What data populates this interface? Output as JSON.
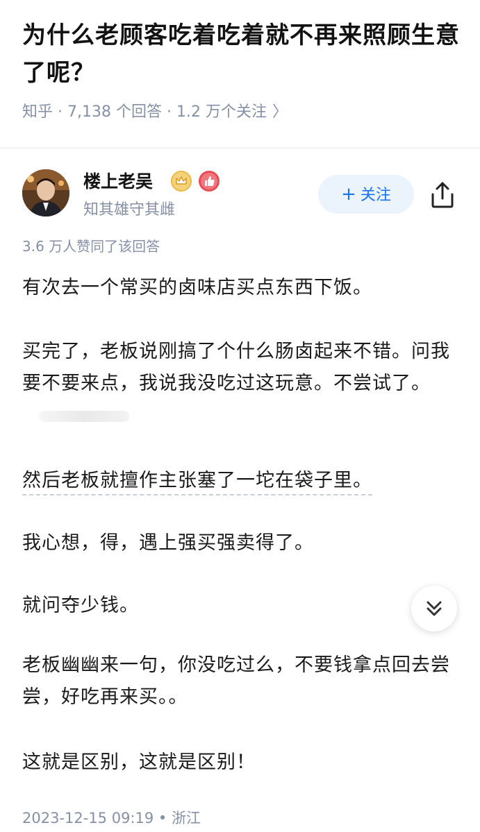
{
  "question": {
    "title": "为什么老顾客吃着吃着就不再来照顾生意了呢？",
    "source": "知乎",
    "answers": "7,138 个回答",
    "followers": "1.2 万个关注",
    "separator": " · ",
    "chevron": "〉"
  },
  "author": {
    "name": "楼上老吴",
    "bio": "知其雄守其雌",
    "follow_label": "关注",
    "follow_plus": "+",
    "colors": {
      "follow_bg": "#ebf3fd",
      "follow_text": "#1772f6"
    }
  },
  "answer": {
    "votes": "3.6 万人赞同了该回答",
    "paragraphs": [
      "有次去一个常买的卤味店买点东西下饭。",
      "买完了，老板说刚搞了个什么肠卤起来不错。问我要不要来点，我说我没吃过这玩意。不尝试了。",
      "然后老板就擅作主张塞了一坨在袋子里。",
      "我心想，得，遇上强买强卖得了。",
      "就问夺少钱。",
      "老板幽幽来一句，你没吃过么，不要钱拿点回去尝尝，好吃再来买。。",
      "这就是区别，这就是区别！"
    ],
    "date": "2023-12-15 09:19",
    "location": "浙江",
    "meta_separator": " • "
  },
  "icons": {
    "share": "share-icon",
    "expand": "double-chevron-down-icon",
    "crown": "crown-badge-icon",
    "like": "thumbs-up-badge-icon"
  }
}
